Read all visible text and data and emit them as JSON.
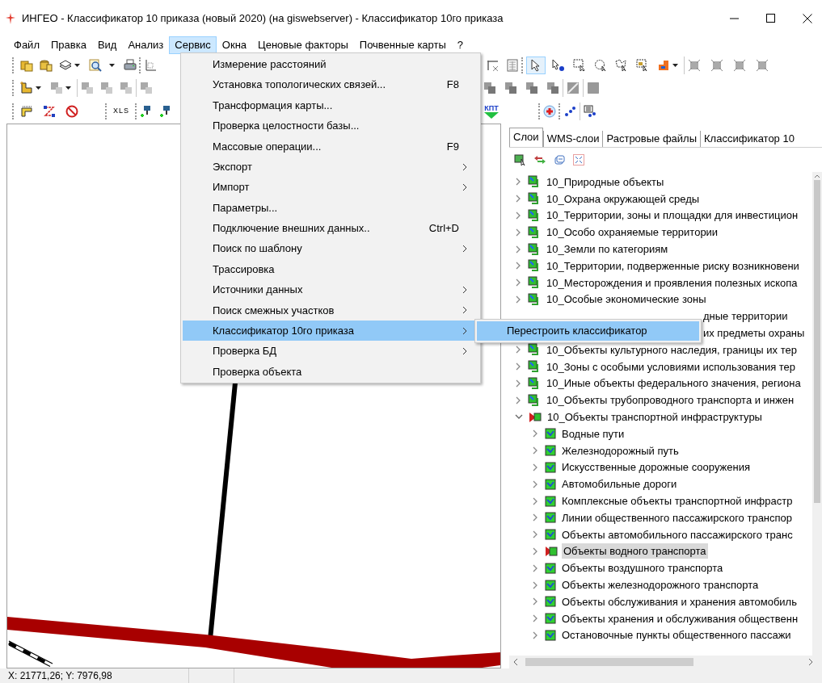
{
  "window": {
    "title": "ИНГЕО - Классификатор 10 приказа (новый 2020) (на giswebserver) - Классификатор 10го приказа"
  },
  "menu_bar": [
    {
      "label": "Файл",
      "selected": false
    },
    {
      "label": "Правка",
      "selected": false
    },
    {
      "label": "Вид",
      "selected": false
    },
    {
      "label": "Анализ",
      "selected": false
    },
    {
      "label": "Сервис",
      "selected": true
    },
    {
      "label": "Окна",
      "selected": false
    },
    {
      "label": "Ценовые факторы",
      "selected": false
    },
    {
      "label": "Почвенные карты",
      "selected": false
    },
    {
      "label": "?",
      "selected": false
    }
  ],
  "toolbar_labels": [
    "XLS",
    "КПТ"
  ],
  "service_menu": [
    {
      "label": "Измерение расстояний",
      "selected": false,
      "submenu": false
    },
    {
      "label": "Установка топологических связей...",
      "shortcut": "F8",
      "selected": false,
      "submenu": false
    },
    {
      "label": "Трансформация карты...",
      "selected": false,
      "submenu": false
    },
    {
      "label": "Проверка целостности базы...",
      "selected": false,
      "submenu": false
    },
    {
      "label": "Массовые операции...",
      "shortcut": "F9",
      "selected": false,
      "submenu": false
    },
    {
      "label": "Экспорт",
      "selected": false,
      "submenu": true
    },
    {
      "label": "Импорт",
      "selected": false,
      "submenu": true
    },
    {
      "label": "Параметры...",
      "selected": false,
      "submenu": false
    },
    {
      "label": "Подключение внешних данных..",
      "shortcut": "Ctrl+D",
      "selected": false,
      "submenu": false
    },
    {
      "label": "Поиск по шаблону",
      "selected": false,
      "submenu": true
    },
    {
      "label": "Трассировка",
      "selected": false,
      "submenu": false
    },
    {
      "label": "Источники данных",
      "selected": false,
      "submenu": true
    },
    {
      "label": "Поиск смежных участков",
      "selected": false,
      "submenu": true
    },
    {
      "label": "Классификатор 10го приказа",
      "selected": true,
      "submenu": true
    },
    {
      "label": "Проверка БД",
      "selected": false,
      "submenu": true
    },
    {
      "label": "Проверка объекта",
      "selected": false,
      "submenu": false
    }
  ],
  "submenu": [
    {
      "label": "Перестроить классификатор",
      "selected": true
    }
  ],
  "panel": {
    "tabs": [
      {
        "label": "Слои",
        "selected": true
      },
      {
        "label": "WMS-слои",
        "selected": false
      },
      {
        "label": "Растровые файлы",
        "selected": false
      },
      {
        "label": "Классификатор 10",
        "selected": false
      }
    ],
    "tree": [
      {
        "kind": "layer",
        "label": "10_Природные объекты",
        "expanded": false,
        "active": false,
        "selected": false
      },
      {
        "kind": "layer",
        "label": "10_Охрана окружающей среды",
        "expanded": false,
        "active": false,
        "selected": false
      },
      {
        "kind": "layer",
        "label": "10_Территории, зоны и площадки для инвестицион",
        "expanded": false,
        "active": false,
        "selected": false
      },
      {
        "kind": "layer",
        "label": "10_Особо охраняемые территории",
        "expanded": false,
        "active": false,
        "selected": false
      },
      {
        "kind": "layer",
        "label": "10_Земли по категориям",
        "expanded": false,
        "active": false,
        "selected": false
      },
      {
        "kind": "layer",
        "label": "10_Территории, подверженные риску возникновени",
        "expanded": false,
        "active": false,
        "selected": false
      },
      {
        "kind": "layer",
        "label": "10_Месторождения и проявления полезных ископа",
        "expanded": false,
        "active": false,
        "selected": false
      },
      {
        "kind": "layer",
        "label": "10_Особые экономические зоны",
        "expanded": false,
        "active": false,
        "selected": false
      },
      {
        "kind": "covered",
        "label": "дные территории"
      },
      {
        "kind": "covered",
        "label": "их предметы охраны"
      },
      {
        "kind": "layer",
        "label": "10_Объекты культурного наследия, границы их тер",
        "expanded": false,
        "active": false,
        "selected": false
      },
      {
        "kind": "layer",
        "label": "10_Зоны с особыми условиями использования тер",
        "expanded": false,
        "active": false,
        "selected": false
      },
      {
        "kind": "layer",
        "label": "10_Иные объекты федерального значения, региона",
        "expanded": false,
        "active": false,
        "selected": false
      },
      {
        "kind": "layer",
        "label": "10_Объекты трубопроводного транспорта и инжен",
        "expanded": false,
        "active": false,
        "selected": false
      },
      {
        "kind": "layer",
        "label": "10_Объекты транспортной инфраструктуры",
        "expanded": true,
        "active": true,
        "selected": false,
        "children": [
          {
            "kind": "layer",
            "label": "Водные пути",
            "expanded": false,
            "active": false,
            "selected": false
          },
          {
            "kind": "layer",
            "label": "Железнодорожный путь",
            "expanded": false,
            "active": false,
            "selected": false
          },
          {
            "kind": "layer",
            "label": "Искусственные дорожные сооружения",
            "expanded": false,
            "active": false,
            "selected": false
          },
          {
            "kind": "layer",
            "label": "Автомобильные дороги",
            "expanded": false,
            "active": false,
            "selected": false
          },
          {
            "kind": "layer",
            "label": "Комплексные объекты транспортной инфрастр",
            "expanded": false,
            "active": false,
            "selected": false
          },
          {
            "kind": "layer",
            "label": "Линии общественного пассажирского транспор",
            "expanded": false,
            "active": false,
            "selected": false
          },
          {
            "kind": "layer",
            "label": "Объекты автомобильного пассажирского транс",
            "expanded": false,
            "active": false,
            "selected": false
          },
          {
            "kind": "layer",
            "label": "Объекты водного транспорта",
            "expanded": false,
            "active": true,
            "selected": true
          },
          {
            "kind": "layer",
            "label": "Объекты воздушного транспорта",
            "expanded": false,
            "active": false,
            "selected": false
          },
          {
            "kind": "layer",
            "label": "Объекты железнодорожного транспорта",
            "expanded": false,
            "active": false,
            "selected": false
          },
          {
            "kind": "layer",
            "label": "Объекты обслуживания и хранения автомобиль",
            "expanded": false,
            "active": false,
            "selected": false
          },
          {
            "kind": "layer",
            "label": "Объекты хранения и обслуживания общественн",
            "expanded": false,
            "active": false,
            "selected": false
          },
          {
            "kind": "layer",
            "label": "Остановочные пункты общественного пассажи",
            "expanded": false,
            "active": false,
            "selected": false
          }
        ]
      }
    ]
  },
  "status_bar": {
    "coordinates": "X: 21771,26; Y: 7976,98"
  }
}
